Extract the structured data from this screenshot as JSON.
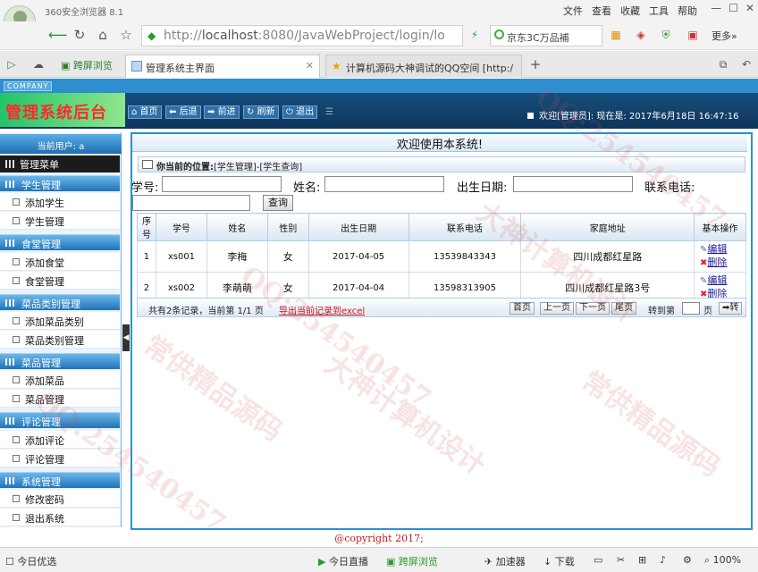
{
  "browser": {
    "title": "360安全浏览器 8.1",
    "menu": [
      "文件",
      "查看",
      "收藏",
      "工具",
      "帮助"
    ],
    "url_prefix": "http://",
    "url_host": "localhost",
    "url_rest": ":8080/JavaWebProject/login/lo",
    "search_text": "京东3C万品補",
    "more_label": "更多»",
    "tabs": [
      {
        "label": "跨屏浏览"
      },
      {
        "label": "管理系统主界面"
      },
      {
        "label": "计算机源码大神调试的QQ空间 [http:/"
      }
    ]
  },
  "header": {
    "company": "COMPANY",
    "brand": "管理系统后台",
    "buttons": [
      "首页",
      "后退",
      "前进",
      "刷新",
      "退出"
    ],
    "welcome": "欢迎[管理员]:  现在是: 2017年6月18日 16:47:16"
  },
  "sidebar": {
    "current_user": "当前用户: a",
    "menu_title": "管理菜单",
    "groups": [
      {
        "title": "学生管理",
        "items": [
          "添加学生",
          "学生管理"
        ]
      },
      {
        "title": "食堂管理",
        "items": [
          "添加食堂",
          "食堂管理"
        ]
      },
      {
        "title": "菜品类别管理",
        "items": [
          "添加菜品类别",
          "菜品类别管理"
        ]
      },
      {
        "title": "菜品管理",
        "items": [
          "添加菜品",
          "菜品管理"
        ]
      },
      {
        "title": "评论管理",
        "items": [
          "添加评论",
          "评论管理"
        ]
      },
      {
        "title": "系统管理",
        "items": [
          "修改密码",
          "退出系统"
        ]
      }
    ]
  },
  "main": {
    "heading": "欢迎使用本系统!",
    "location_label": "你当前的位置:",
    "location_path": "[学生管理]-[学生查询]",
    "search": {
      "xuehao_label": "学号:",
      "name_label": "姓名:",
      "birth_label": "出生日期:",
      "phone_label": "联系电话:",
      "button": "查询"
    },
    "table": {
      "headers": [
        "序号",
        "学号",
        "姓名",
        "性别",
        "出生日期",
        "联系电话",
        "家庭地址",
        "基本操作"
      ],
      "rows": [
        [
          "1",
          "xs001",
          "李梅",
          "女",
          "2017-04-05",
          "13539843343",
          "四川成都红星路"
        ],
        [
          "2",
          "xs002",
          "李萌萌",
          "女",
          "2017-04-04",
          "13598313905",
          "四川成都红星路3号"
        ]
      ],
      "edit_label": "编辑",
      "delete_label": "删除"
    },
    "pager": {
      "info": "共有2条记录，当前第 1/1 页",
      "export": "导出当前记录到excel",
      "first": "首页",
      "prev": "上一页",
      "next": "下一页",
      "last": "尾页",
      "goto": "转到第",
      "page_unit": "页",
      "go": "➡转"
    }
  },
  "footer": {
    "copyright": "@copyright 2017;"
  },
  "status_bar": {
    "left": "今日优选",
    "live": "今日直播",
    "cross": "跨屏浏览",
    "accel": "加速器",
    "download": "下载",
    "zoom": "100%"
  },
  "watermarks": [
    "大神计算机设计",
    "QQ:254540457",
    "常供精品源码",
    "大神计算机设计",
    "QQ:254540457",
    "常供精品源码",
    "QQ:254540457"
  ]
}
